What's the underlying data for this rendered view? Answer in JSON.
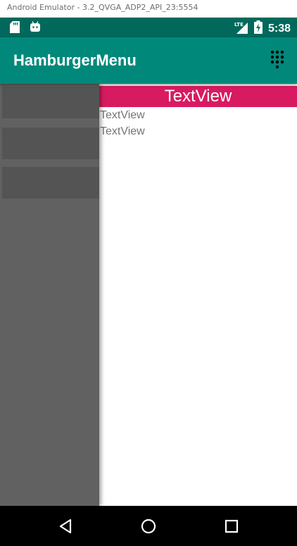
{
  "window": {
    "title": "Android Emulator - 3.2_QVGA_ADP2_API_23:5554"
  },
  "status_bar": {
    "time": "5:38",
    "network_label": "LTE",
    "icons": [
      "sd-card-icon",
      "android-debug-icon",
      "lte-signal-icon",
      "battery-charging-icon"
    ]
  },
  "app_bar": {
    "title": "HamburgerMenu",
    "menu_icon": "dialpad-icon"
  },
  "drawer": {
    "items": [
      "",
      "",
      ""
    ]
  },
  "content": {
    "header": "TextView",
    "lines": [
      "TextView",
      "TextView"
    ]
  },
  "nav_bar": {
    "icons": [
      "back-triangle-icon",
      "home-circle-icon",
      "recents-square-icon"
    ]
  },
  "colors": {
    "status_bar": "#00695c",
    "app_bar": "#00897b",
    "header_accent": "#d81b60",
    "drawer": "#616161",
    "drawer_item": "#545454"
  }
}
